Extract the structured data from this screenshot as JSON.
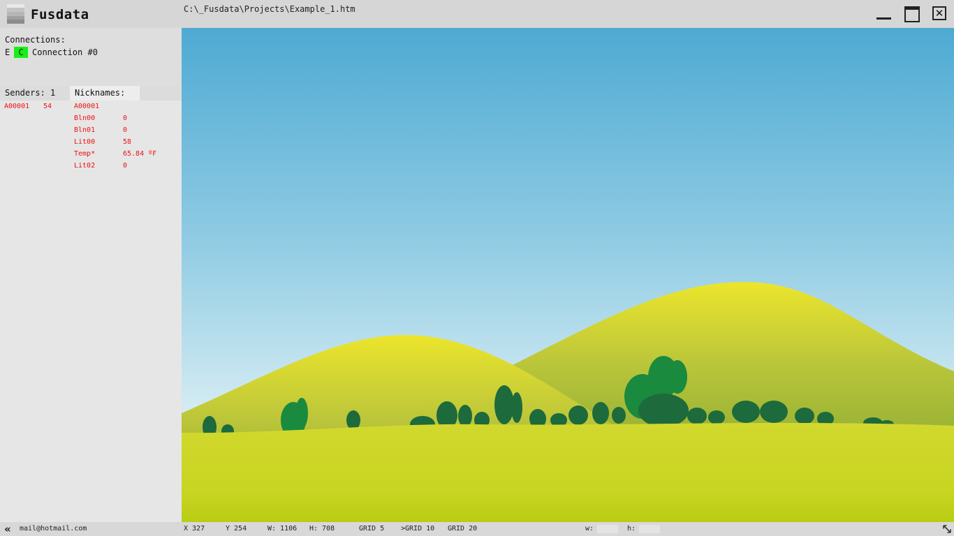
{
  "app": {
    "title": "Fusdata",
    "file_path": "C:\\_Fusdata\\Projects\\Example_1.htm"
  },
  "connections": {
    "title": "Connections:",
    "items": [
      {
        "e_label": "E",
        "c_label": "C",
        "name": "Connection #0",
        "c_color": "#17f017"
      }
    ]
  },
  "tabs": {
    "senders": "Senders: 1",
    "nicknames": "Nicknames:"
  },
  "senders": [
    {
      "id": "A00001",
      "value": "54"
    }
  ],
  "nicknames": {
    "header": "A00001",
    "items": [
      {
        "name": "Bln00",
        "value": "0"
      },
      {
        "name": "Bln01",
        "value": "0"
      },
      {
        "name": "Lit00",
        "value": "58"
      },
      {
        "name": "Temp*",
        "value": "65.84 ºF"
      },
      {
        "name": "Lit02",
        "value": "0"
      }
    ]
  },
  "status": {
    "email": "mail@hotmail.com",
    "x": "X 327",
    "y": "Y 254",
    "w": "W: 1106",
    "h": "H: 708",
    "grid5": "GRID 5",
    "grid10": ">GRID 10",
    "grid20": "GRID 20",
    "w_label": "w:",
    "h_label": "h:",
    "w_value": "",
    "h_value": ""
  },
  "colors": {
    "accent_text": "#ee1111",
    "connection_active": "#17f017"
  },
  "icons": {
    "collapse": "double-chevron-left-icon",
    "resize": "resize-diagonal-icon",
    "minimize": "minimize-icon",
    "maximize": "maximize-icon",
    "close": "close-icon"
  }
}
